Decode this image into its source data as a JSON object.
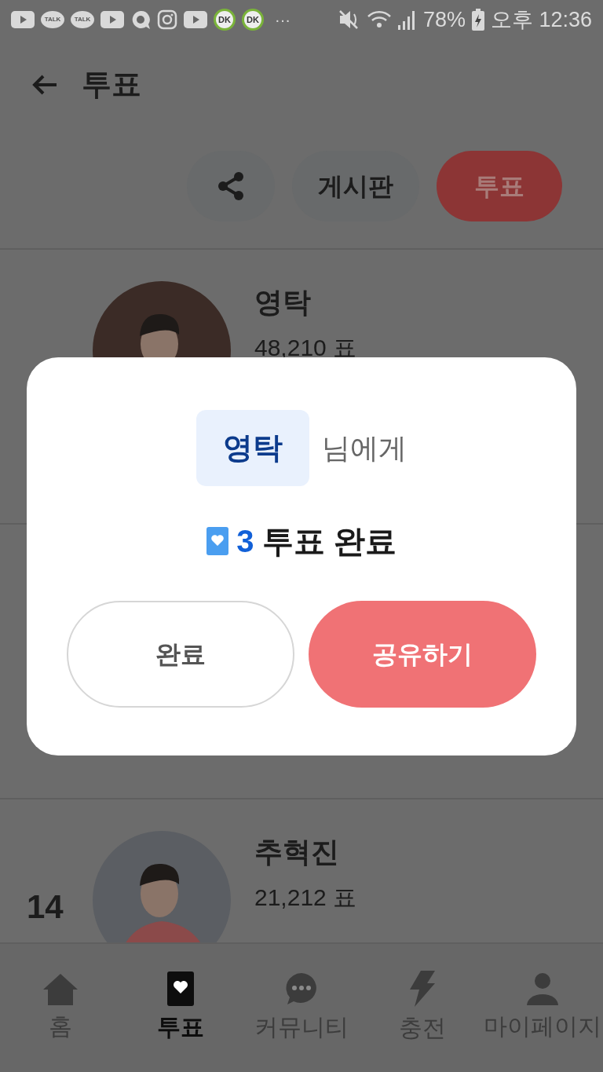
{
  "status_bar": {
    "notifications": [
      {
        "kind": "play"
      },
      {
        "kind": "talk",
        "label": "TALK"
      },
      {
        "kind": "talk",
        "label": "TALK"
      },
      {
        "kind": "play"
      },
      {
        "kind": "chat"
      },
      {
        "kind": "camera"
      },
      {
        "kind": "play"
      },
      {
        "kind": "badge",
        "label": "DK"
      },
      {
        "kind": "badge",
        "label": "DK"
      }
    ],
    "more": "···",
    "battery": "78%",
    "time": "오후 12:36"
  },
  "header": {
    "title": "투표"
  },
  "top_card": {
    "board_button": "게시판",
    "vote_button": "투표"
  },
  "rows": [
    {
      "name": "영탁",
      "votes": "48,210 표"
    },
    {
      "rank": "14",
      "name": "추혁진",
      "votes": "21,212 표"
    }
  ],
  "dialog": {
    "recipient": "영탁",
    "suffix": "님에게",
    "count": "3",
    "result": "투표 완료",
    "buttons": [
      {
        "kind": "secondary",
        "label": "완료"
      },
      {
        "kind": "primary",
        "label": "공유하기"
      }
    ]
  },
  "nav": [
    {
      "kind": "home",
      "label": "홈",
      "selected": false
    },
    {
      "kind": "vote",
      "label": "투표",
      "selected": true
    },
    {
      "kind": "community",
      "label": "커뮤니티",
      "selected": false
    },
    {
      "kind": "charge",
      "label": "충전",
      "selected": false
    },
    {
      "kind": "profile",
      "label": "마이페이지",
      "selected": false
    }
  ]
}
